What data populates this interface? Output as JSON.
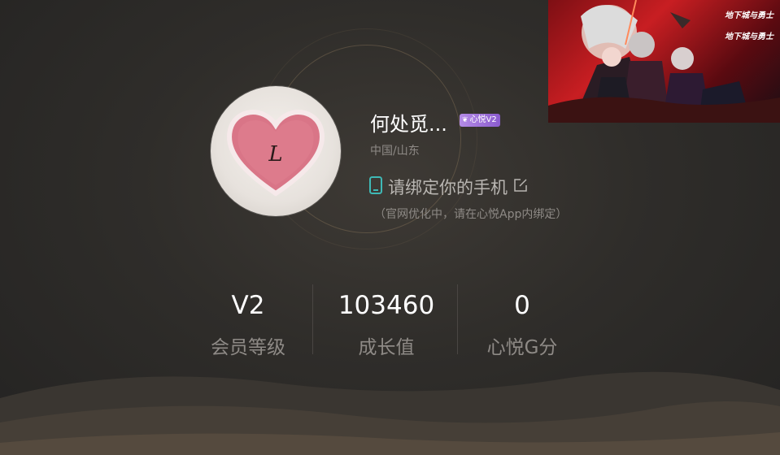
{
  "profile": {
    "nickname": "何处觅...",
    "vip_badge": "心悦V2",
    "region": "中国/山东",
    "avatar_letter": "L"
  },
  "phone": {
    "bind_text": "请绑定你的手机",
    "note": "（官网优化中，请在心悦App内绑定）"
  },
  "stats": [
    {
      "value": "V2",
      "label": "会员等级"
    },
    {
      "value": "103460",
      "label": "成长值"
    },
    {
      "value": "0",
      "label": "心悦G分"
    }
  ],
  "banner": {
    "logo_1": "地下城与勇士",
    "logo_2": "地下城与勇士"
  },
  "colors": {
    "accent_teal": "#3fb9b6",
    "badge_purple": "#a67ddd",
    "muted_text": "#8e8a86"
  }
}
